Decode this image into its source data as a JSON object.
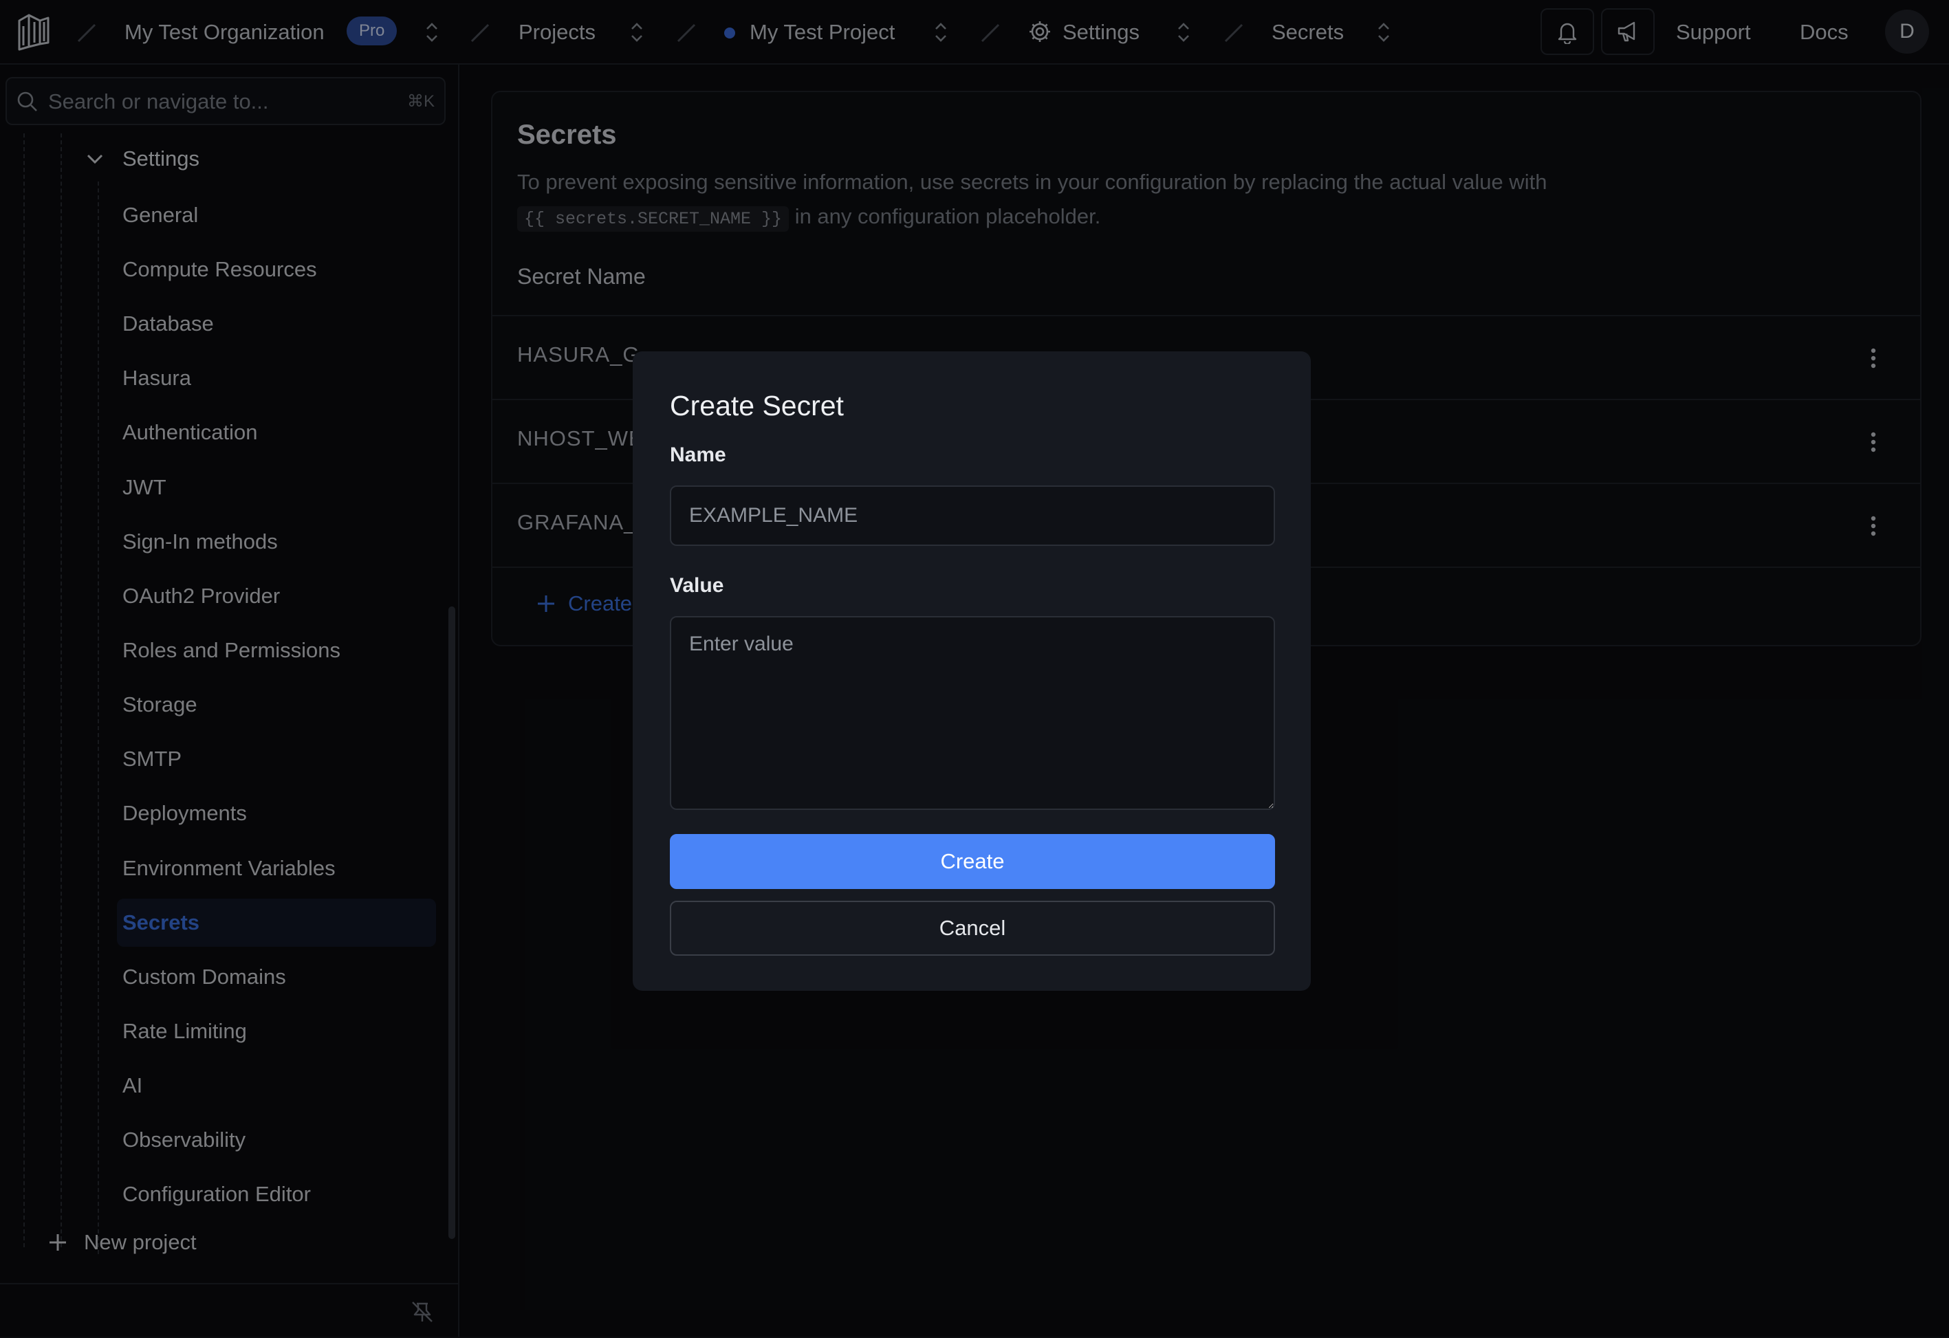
{
  "topbar": {
    "organization": "My Test Organization",
    "plan_badge": "Pro",
    "projects": "Projects",
    "project_name": "My Test Project",
    "settings": "Settings",
    "current_page": "Secrets",
    "support": "Support",
    "docs": "Docs",
    "avatar_initial": "D",
    "icons": [
      "nhost-logo-icon",
      "bell-icon",
      "megaphone-icon",
      "gear-icon",
      "chevron-up-down-icon"
    ]
  },
  "sidebar": {
    "search_placeholder": "Search or navigate to...",
    "search_shortcut": "⌘K",
    "section": "Settings",
    "items": [
      {
        "label": "General"
      },
      {
        "label": "Compute Resources"
      },
      {
        "label": "Database"
      },
      {
        "label": "Hasura"
      },
      {
        "label": "Authentication"
      },
      {
        "label": "JWT"
      },
      {
        "label": "Sign-In methods"
      },
      {
        "label": "OAuth2 Provider"
      },
      {
        "label": "Roles and Permissions"
      },
      {
        "label": "Storage"
      },
      {
        "label": "SMTP"
      },
      {
        "label": "Deployments"
      },
      {
        "label": "Environment Variables"
      },
      {
        "label": "Secrets"
      },
      {
        "label": "Custom Domains"
      },
      {
        "label": "Rate Limiting"
      },
      {
        "label": "AI"
      },
      {
        "label": "Observability"
      },
      {
        "label": "Configuration Editor"
      }
    ],
    "active_item": "Secrets",
    "new_project": "New project"
  },
  "main": {
    "title": "Secrets",
    "description_before": "To prevent exposing sensitive information, use secrets in your configuration by replacing the actual value with",
    "code_snippet": "{{ secrets.SECRET_NAME }}",
    "description_after": "in any configuration placeholder.",
    "column_header": "Secret Name",
    "rows": [
      {
        "name": "HASURA_G"
      },
      {
        "name": "NHOST_WE"
      },
      {
        "name": "GRAFANA_"
      }
    ],
    "create_link": "Create"
  },
  "modal": {
    "title": "Create Secret",
    "name_label": "Name",
    "name_placeholder": "EXAMPLE_NAME",
    "value_label": "Value",
    "value_placeholder": "Enter value",
    "create_button": "Create",
    "cancel_button": "Cancel"
  },
  "colors": {
    "accent": "#4a84f7",
    "active_text": "#3d74e6",
    "background": "#0b0c0f",
    "modal_bg": "#161920"
  }
}
